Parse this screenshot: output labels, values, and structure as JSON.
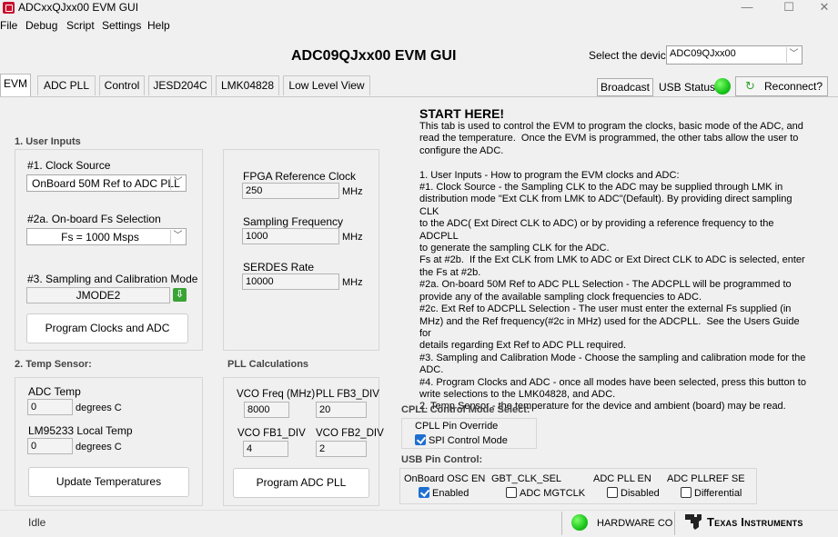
{
  "window": {
    "title": "ADCxxQJxx00 EVM GUI",
    "min": "—",
    "max": "☐",
    "close": "✕"
  },
  "menu": [
    "File",
    "Debug",
    "Script",
    "Settings",
    "Help"
  ],
  "header": {
    "title": "ADC09QJxx00 EVM GUI",
    "device_label": "Select the device",
    "device_value": "ADC09QJxx00"
  },
  "tabs": [
    "EVM",
    "ADC PLL",
    "Control",
    "JESD204C",
    "LMK04828",
    "Low Level View"
  ],
  "toolbar": {
    "broadcast": "Broadcast",
    "usb_status": "USB Status",
    "reconnect": "Reconnect?"
  },
  "user_inputs": {
    "title": "1. User Inputs",
    "clock_source_label": "#1. Clock Source",
    "clock_source_value": "OnBoard 50M Ref to ADC PLL",
    "fs_label": "#2a. On-board Fs Selection",
    "fs_value": "Fs = 1000 Msps",
    "mode_label": "#3. Sampling and Calibration Mode",
    "mode_value": "JMODE2",
    "program_button": "Program Clocks and ADC"
  },
  "clocks": {
    "fpga_label": "FPGA Reference Clock",
    "fpga_value": "250",
    "fpga_unit": "MHz",
    "fs_label": "Sampling Frequency",
    "fs_value": "1000",
    "fs_unit": "MHz",
    "serdes_label": "SERDES Rate",
    "serdes_value": "10000",
    "serdes_unit": "MHz"
  },
  "temp": {
    "title": "2. Temp Sensor:",
    "adc_label": "ADC Temp",
    "adc_value": "0",
    "adc_unit": "degrees C",
    "lm_label": "LM95233 Local Temp",
    "lm_value": "0",
    "lm_unit": "degrees C",
    "update_button": "Update Temperatures"
  },
  "pll": {
    "title": "PLL Calculations",
    "vco_label": "VCO Freq (MHz)",
    "vco_value": "8000",
    "fb3_label": "PLL FB3_DIV",
    "fb3_value": "20",
    "fb1_label": "VCO FB1_DIV",
    "fb1_value": "4",
    "fb2_label": "VCO FB2_DIV",
    "fb2_value": "2",
    "program_button": "Program ADC PLL"
  },
  "help": {
    "title": "START HERE!",
    "text": "This tab is used to control the EVM to program the clocks, basic mode of the ADC, and\nread the temperature.  Once the EVM is programmed, the other tabs allow the user to\nconfigure the ADC.\n\n1. User Inputs - How to program the EVM clocks and ADC:\n#1. Clock Source - the Sampling CLK to the ADC may be supplied through LMK in\ndistribution mode \"Ext CLK from LMK to ADC\"(Default). By providing direct sampling CLK\nto the ADC( Ext Direct CLK to ADC) or by providing a reference frequency to the ADCPLL\nto generate the sampling CLK for the ADC.\nFs at #2b.  If the Ext CLK from LMK to ADC or Ext Direct CLK to ADC is selected, enter\nthe Fs at #2b.\n#2a. On-board 50M Ref to ADC PLL Selection - The ADCPLL will be programmed to\nprovide any of the available sampling clock frequencies to ADC.\n#2c. Ext Ref to ADCPLL Selection - The user must enter the external Fs supplied (in\nMHz) and the Ref frequency(#2c in MHz) used for the ADCPLL.  See the Users Guide for\ndetails regarding Ext Ref to ADC PLL required.\n#3. Sampling and Calibration Mode - Choose the sampling and calibration mode for the\nADC.\n#4. Program Clocks and ADC - once all modes have been selected, press this button to\nwrite selections to the LMK04828, and ADC.\n2. Temp Sensor - the temperature for the device and ambient (board) may be read."
  },
  "cpll": {
    "title": "CPLL Control Mode Select:",
    "override_label": "CPLL Pin Override",
    "spi_label": "SPI Control Mode",
    "spi_checked": true
  },
  "usb_pin": {
    "title": "USB Pin Control:",
    "osc_label": "OnBoard OSC EN",
    "osc_check": "Enabled",
    "osc_checked": true,
    "gbt_label": "GBT_CLK_SEL",
    "gbt_check": "ADC MGTCLK",
    "gbt_checked": false,
    "pll_en_label": "ADC PLL EN",
    "pll_en_check": "Disabled",
    "pll_en_checked": false,
    "pllref_label": "ADC PLLREF SE",
    "pllref_check": "Differential",
    "pllref_checked": false
  },
  "status": {
    "state": "Idle",
    "hardware": "HARDWARE CO",
    "brand": "Texas Instruments"
  },
  "colors": {
    "led_green": "#19c51a",
    "check_blue": "#1e6fd0",
    "mode_green": "#3aa336",
    "ti_red": "#c8102e"
  }
}
